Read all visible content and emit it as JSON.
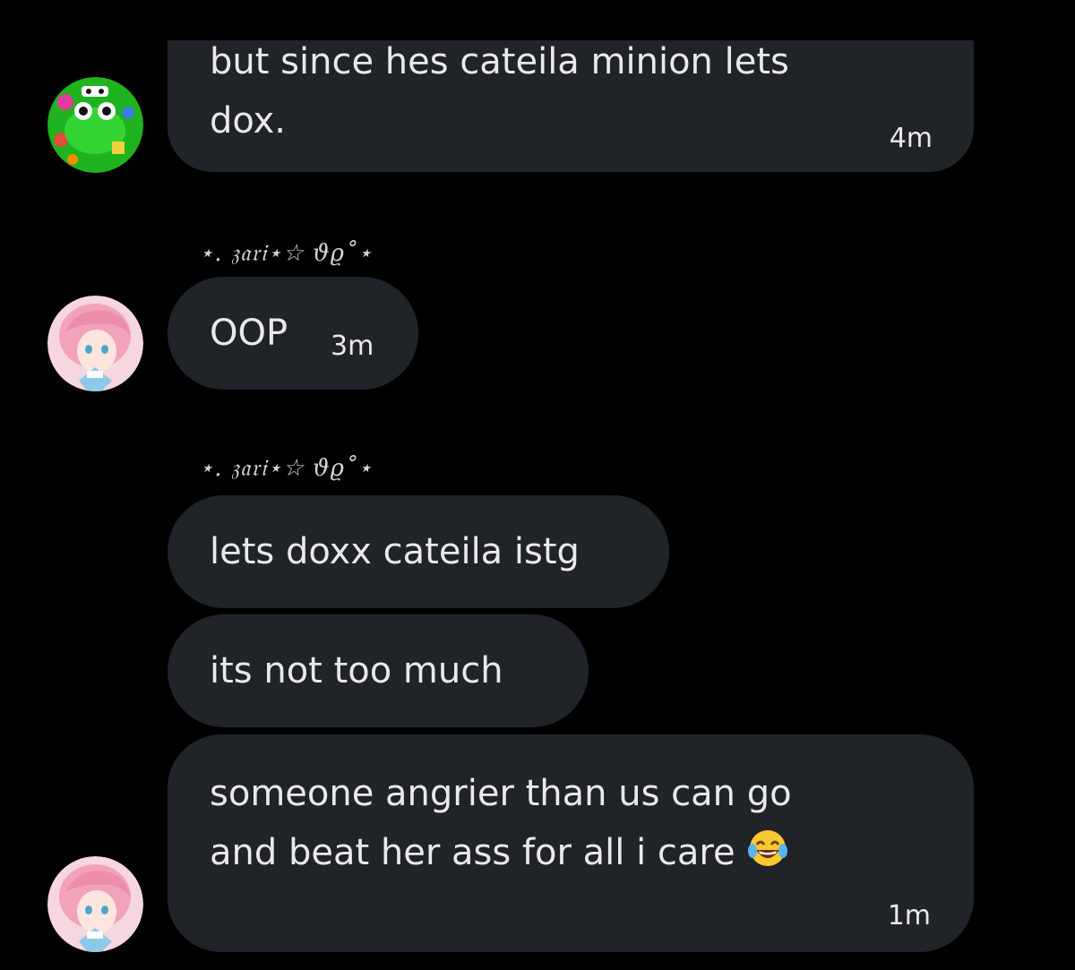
{
  "conversation": {
    "messages": [
      {
        "lines": [
          "but since hes cateila minion lets",
          "dox."
        ],
        "time": "4m"
      },
      {
        "sender": "⋆. 𝔷𝔞𝔯𝔦⋆☆ 𝜗𝜚˚⋆",
        "text": "OOP",
        "time": "3m"
      },
      {
        "sender": "⋆. 𝔷𝔞𝔯𝔦⋆☆ 𝜗𝜚˚⋆",
        "text": "lets doxx cateila istg"
      },
      {
        "text": "its not too much"
      },
      {
        "lines": [
          "someone angrier than us can go",
          "and beat her ass for all i care"
        ],
        "emoji": "face-with-tears-of-joy",
        "time": "1m"
      }
    ]
  },
  "colors": {
    "background": "#000000",
    "bubble": "#202327",
    "text": "#e7e9ea"
  },
  "icons": {
    "avatar_1": "green-frog-avatar",
    "avatar_2": "pink-haired-anime-girl-avatar",
    "emoji": "face-with-tears-of-joy-icon"
  }
}
